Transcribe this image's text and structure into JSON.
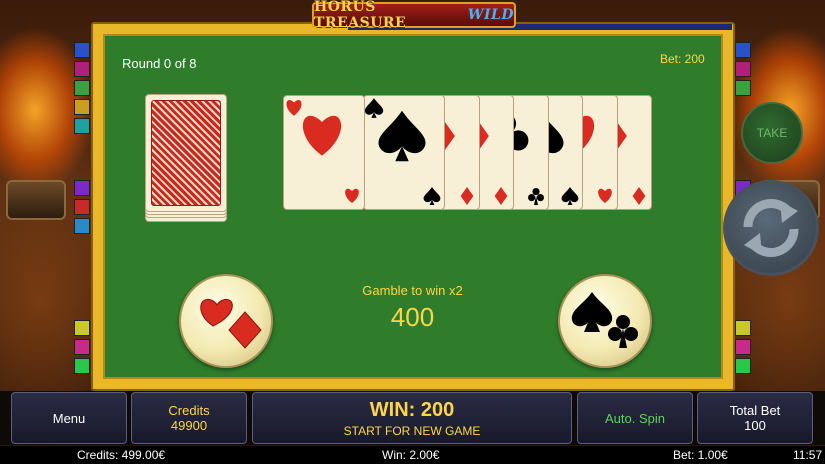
{
  "logo": {
    "main": "HORUS TREASURE",
    "suffix": "WILD"
  },
  "gamble": {
    "round_text": "Round 0 of 8",
    "bet_text": "Bet: 200",
    "prompt": "Gamble to win x2",
    "amount": "400",
    "history": [
      {
        "rank_suit": "hearts",
        "color": "red"
      },
      {
        "rank_suit": "spades",
        "color": "black"
      },
      {
        "rank_suit": "diamonds",
        "color": "red"
      },
      {
        "rank_suit": "diamonds",
        "color": "red"
      },
      {
        "rank_suit": "clubs",
        "color": "black"
      },
      {
        "rank_suit": "spades",
        "color": "black"
      },
      {
        "rank_suit": "hearts",
        "color": "red"
      },
      {
        "rank_suit": "diamonds",
        "color": "red"
      }
    ],
    "red_button_icon": "hearts-diamonds-icon",
    "black_button_icon": "spades-clubs-icon"
  },
  "side": {
    "take_label": "TAKE",
    "spin_icon": "refresh-arrows-icon"
  },
  "controls": {
    "menu_label": "Menu",
    "credits_label": "Credits",
    "credits_value": "49900",
    "win_text": "WIN: 200",
    "start_text": "START FOR NEW GAME",
    "autospin_label": "Auto. Spin",
    "total_bet_label": "Total Bet",
    "total_bet_value": "100"
  },
  "status": {
    "credits": "Credits: 499.00€",
    "win": "Win: 2.00€",
    "bet": "Bet: 1.00€",
    "time": "11:57"
  },
  "colors": {
    "felt": "#2f7d2a",
    "gold": "#ffd54a",
    "card_red": "#d92b20",
    "card_black": "#000000"
  }
}
